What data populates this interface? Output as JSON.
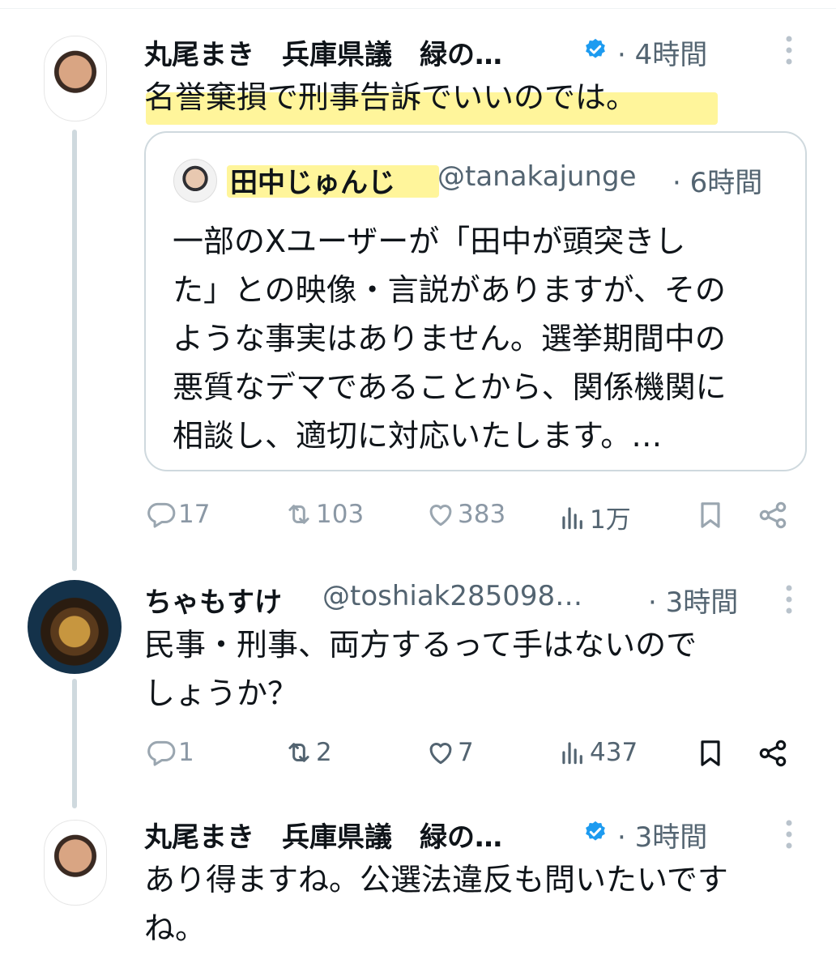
{
  "tweets": [
    {
      "author": "丸尾まき　兵庫県議　緑の…",
      "time": "· 4時間",
      "text": "名誉棄損で刑事告訴でいいのでは。",
      "quote": {
        "author": "田中じゅんじ",
        "handle": "@tanakajunge",
        "time": "· 6時間",
        "lines": [
          "一部のXユーザーが「田中が頭突きし",
          "た」との映像・言説がありますが、その",
          "ような事実はありません。選挙期間中の",
          "悪質なデマであることから、関係機関に",
          "相談し、適切に対応いたします。…"
        ]
      },
      "stats": {
        "replies": "17",
        "reposts": "103",
        "likes": "383",
        "views": "1万"
      }
    },
    {
      "author": "ちゃもすけ",
      "handle": "@toshiak285098…",
      "time": "· 3時間",
      "lines": [
        "民事・刑事、両方するって手はないので",
        "しょうか？"
      ],
      "stats": {
        "replies": "1",
        "reposts": "2",
        "likes": "7",
        "views": "437"
      }
    },
    {
      "author": "丸尾まき　兵庫県議　緑の…",
      "time": "· 3時間",
      "lines": [
        "あり得ますね。公選法違反も問いたいです",
        "ね。"
      ]
    }
  ],
  "colors": {
    "verified": "#1d9bf0",
    "highlight": "#fff27a",
    "thread_line": "#cfd9de"
  },
  "icons": [
    "verified-badge-icon",
    "more-dots-icon",
    "reply-icon",
    "repost-icon",
    "like-icon",
    "views-icon",
    "bookmark-icon",
    "share-icon"
  ]
}
